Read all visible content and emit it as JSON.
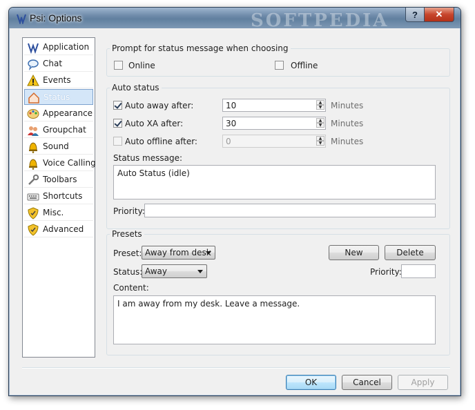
{
  "window": {
    "title": "Psi: Options",
    "watermark": "SOFTPEDIA",
    "help_label": "?",
    "close_label": "✕"
  },
  "sidebar": {
    "items": [
      {
        "label": "Application",
        "icon": "psi-logo-icon"
      },
      {
        "label": "Chat",
        "icon": "chat-bubble-icon"
      },
      {
        "label": "Events",
        "icon": "warning-icon"
      },
      {
        "label": "Status",
        "icon": "status-house-icon"
      },
      {
        "label": "Appearance",
        "icon": "palette-icon"
      },
      {
        "label": "Groupchat",
        "icon": "users-icon"
      },
      {
        "label": "Sound",
        "icon": "bell-icon"
      },
      {
        "label": "Voice Calling",
        "icon": "bell-icon"
      },
      {
        "label": "Toolbars",
        "icon": "toolbar-icon"
      },
      {
        "label": "Shortcuts",
        "icon": "keyboard-icon"
      },
      {
        "label": "Misc.",
        "icon": "shield-icon"
      },
      {
        "label": "Advanced",
        "icon": "shield-icon"
      }
    ],
    "selected": "Status"
  },
  "prompt_group": {
    "title": "Prompt for status message when choosing",
    "online_label": "Online",
    "offline_label": "Offline",
    "online_checked": false,
    "offline_checked": false
  },
  "auto_status": {
    "title": "Auto status",
    "away_label": "Auto away after:",
    "away_value": "10",
    "away_checked": true,
    "xa_label": "Auto XA after:",
    "xa_value": "30",
    "xa_checked": true,
    "offline_label": "Auto offline after:",
    "offline_value": "0",
    "offline_checked": false,
    "unit": "Minutes",
    "status_message_label": "Status message:",
    "status_message": "Auto Status (idle)",
    "priority_label": "Priority:",
    "priority_value": ""
  },
  "presets": {
    "title": "Presets",
    "preset_label": "Preset:",
    "preset_value": "Away from desk",
    "status_label": "Status:",
    "status_value": "Away",
    "priority_label": "Priority:",
    "priority_value": "",
    "new_label": "New",
    "delete_label": "Delete",
    "content_label": "Content:",
    "content_value": "I am away from my desk.  Leave a message."
  },
  "buttons": {
    "ok": "OK",
    "cancel": "Cancel",
    "apply": "Apply"
  },
  "colors": {
    "selection": "#d4e6f8",
    "titlebar": "#6e8aa9",
    "close": "#c7452c"
  }
}
